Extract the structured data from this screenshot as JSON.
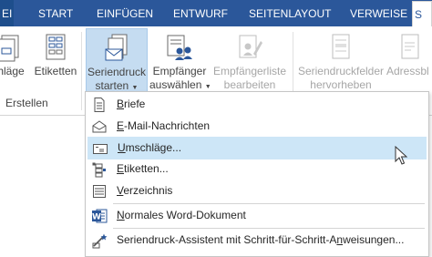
{
  "tabs": [
    {
      "key": "file",
      "label": "EI"
    },
    {
      "key": "start",
      "label": "START"
    },
    {
      "key": "einfuegen",
      "label": "EINFÜGEN"
    },
    {
      "key": "entwurf",
      "label": "ENTWURF"
    },
    {
      "key": "seitenlayout",
      "label": "SEITENLAYOUT"
    },
    {
      "key": "verweise",
      "label": "VERWEISE"
    },
    {
      "key": "sendungen",
      "label": "S"
    }
  ],
  "ribbon": {
    "umschlaege_label": "chläge",
    "etiketten_label": "Etiketten",
    "group_erstellen": "Erstellen",
    "seriendruck_line1": "Seriendruck",
    "seriendruck_line2": "starten",
    "empfaenger_line1": "Empfänger",
    "empfaenger_line2": "auswählen",
    "empfaengerliste_line1": "Empfängerliste",
    "empfaengerliste_line2": "bearbeiten",
    "felder_line1": "Seriendruckfelder",
    "felder_line2": "hervorheben",
    "adressblock_line1": "Adressbl"
  },
  "menu": {
    "items": [
      {
        "pre": "",
        "ul": "B",
        "post": "riefe",
        "icon": "letter-icon"
      },
      {
        "pre": "",
        "ul": "E",
        "post": "-Mail-Nachrichten",
        "icon": "email-icon"
      },
      {
        "pre": "",
        "ul": "U",
        "post": "mschläge...",
        "icon": "envelope-icon"
      },
      {
        "pre": "",
        "ul": "E",
        "post": "tiketten...",
        "icon": "labels-icon"
      },
      {
        "pre": "",
        "ul": "V",
        "post": "erzeichnis",
        "icon": "directory-icon"
      },
      {
        "pre": "",
        "ul": "N",
        "post": "ormales Word-Dokument",
        "icon": "word-icon"
      },
      {
        "pre": "Seriendruck-Assistent mit Schritt-für-Schritt-A",
        "ul": "n",
        "post": "weisungen...",
        "icon": "wizard-icon"
      }
    ]
  },
  "colors": {
    "tabbar": "#2b579a",
    "selected": "#c5dcf1",
    "hover": "#cde6f7",
    "word_icon": "#2b579a"
  }
}
